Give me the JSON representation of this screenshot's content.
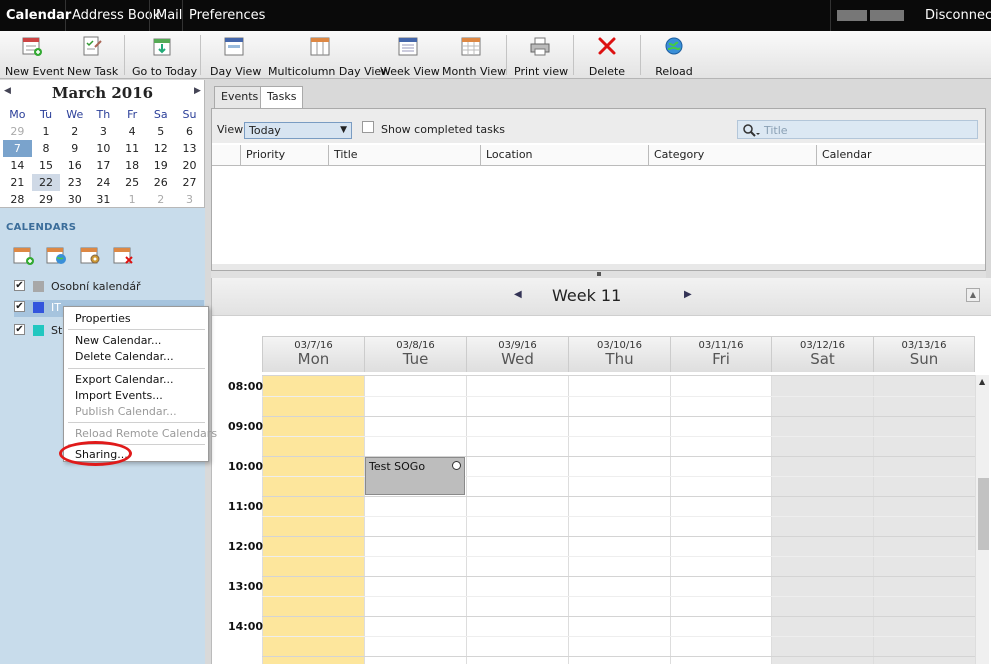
{
  "topnav": {
    "tabs": [
      "Calendar",
      "Address Book",
      "Mail",
      "Preferences"
    ],
    "disconnect": "Disconnect"
  },
  "toolbar": {
    "new_event": "New Event",
    "new_task": "New Task",
    "go_to_today": "Go to Today",
    "day_view": "Day View",
    "multicolumn_day_view": "Multicolumn Day View",
    "week_view": "Week View",
    "month_view": "Month View",
    "print_view": "Print view",
    "delete": "Delete",
    "reload": "Reload"
  },
  "minical": {
    "title": "March 2016",
    "weekdays": [
      "Mo",
      "Tu",
      "We",
      "Th",
      "Fr",
      "Sa",
      "Su"
    ],
    "weeks": [
      [
        "29",
        "1",
        "2",
        "3",
        "4",
        "5",
        "6"
      ],
      [
        "7",
        "8",
        "9",
        "10",
        "11",
        "12",
        "13"
      ],
      [
        "14",
        "15",
        "16",
        "17",
        "18",
        "19",
        "20"
      ],
      [
        "21",
        "22",
        "23",
        "24",
        "25",
        "26",
        "27"
      ],
      [
        "28",
        "29",
        "30",
        "31",
        "1",
        "2",
        "3"
      ]
    ]
  },
  "calendars": {
    "heading": "CALENDARS",
    "items": [
      {
        "name": "Osobní kalendář",
        "color": "#a8a8a8"
      },
      {
        "name": "IT",
        "color": "#3355dd"
      },
      {
        "name": "St",
        "color": "#22c7c0"
      }
    ]
  },
  "context_menu": {
    "properties": "Properties",
    "new_calendar": "New Calendar...",
    "delete_calendar": "Delete Calendar...",
    "export_calendar": "Export Calendar...",
    "import_events": "Import Events...",
    "publish_calendar": "Publish Calendar...",
    "reload_remote": "Reload Remote Calendars",
    "sharing": "Sharing..."
  },
  "tasks": {
    "tab_events": "Events",
    "tab_tasks": "Tasks",
    "view_label": "View",
    "view_value": "Today",
    "show_completed": "Show completed tasks",
    "search_placeholder": "Title",
    "columns": [
      "Priority",
      "Title",
      "Location",
      "Category",
      "Calendar"
    ]
  },
  "week": {
    "title": "Week 11",
    "days": [
      {
        "date": "03/7/16",
        "name": "Mon"
      },
      {
        "date": "03/8/16",
        "name": "Tue"
      },
      {
        "date": "03/9/16",
        "name": "Wed"
      },
      {
        "date": "03/10/16",
        "name": "Thu"
      },
      {
        "date": "03/11/16",
        "name": "Fri"
      },
      {
        "date": "03/12/16",
        "name": "Sat"
      },
      {
        "date": "03/13/16",
        "name": "Sun"
      }
    ],
    "hours": [
      "08:00",
      "09:00",
      "10:00",
      "11:00",
      "12:00",
      "13:00",
      "14:00"
    ],
    "event": {
      "title": "Test SOGo"
    }
  },
  "colors": {
    "today_column": "#fde69c",
    "weekend_column": "#e6e6e6",
    "selection_ring": "#e01a1a"
  }
}
